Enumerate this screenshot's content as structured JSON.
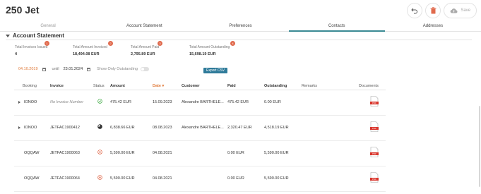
{
  "header": {
    "title": "250 Jet",
    "save_label": "Save"
  },
  "tabs": [
    {
      "label": "General"
    },
    {
      "label": "Account Statement"
    },
    {
      "label": "Preferences"
    },
    {
      "label": "Contacts"
    },
    {
      "label": "Addresses"
    }
  ],
  "section": {
    "title": "Account Statement"
  },
  "summary": [
    {
      "badge": "1",
      "label": "Total Invoices Issued",
      "value": "4"
    },
    {
      "badge": "2",
      "label": "Total Amount Invoiced",
      "value": "18,494.08 EUR"
    },
    {
      "badge": "3",
      "label": "Total Amount Paid",
      "value": "2,795.89 EUR"
    },
    {
      "badge": "4",
      "label": "Total Amount Outstanding",
      "value": "15,698.19 EUR"
    }
  ],
  "filters": {
    "date_from": "04.10.2019",
    "until_label": "until",
    "date_to": "23.01.2024",
    "outstanding_label": "Show Only Outstanding",
    "export_label": "Export CSV"
  },
  "table": {
    "headers": {
      "booking": "Booking",
      "invoice": "Invoice",
      "status": "Status",
      "amount": "Amount",
      "date": "Date",
      "customer": "Customer",
      "paid": "Paid",
      "outstanding": "Outstanding",
      "remarks": "Remarks",
      "documents": "Documents"
    },
    "rows": [
      {
        "booking": "IONOO",
        "invoice": "No Invoice Number",
        "status": "paid",
        "amount": "475.42 EUR",
        "date": "15.09.2023",
        "customer": "Alexandre BARTHELE...",
        "paid": "475.42 EUR",
        "outstanding": "0.00 EUR",
        "remarks": ""
      },
      {
        "booking": "IONOO",
        "invoice": "JETFAC1900412",
        "status": "partial",
        "amount": "6,838.66 EUR",
        "date": "08.08.2023",
        "customer": "Alexandre BARTHELE...",
        "paid": "2,320.47 EUR",
        "outstanding": "4,518.19 EUR",
        "remarks": ""
      },
      {
        "booking": "OQQAW",
        "invoice": "JETFAC1900063",
        "status": "unpaid",
        "amount": "5,590.00 EUR",
        "date": "04.08.2021",
        "customer": "",
        "paid": "0.00 EUR",
        "outstanding": "5,590.00 EUR",
        "remarks": ""
      },
      {
        "booking": "OQQAW",
        "invoice": "JETFAC1900064",
        "status": "unpaid",
        "amount": "5,590.00 EUR",
        "date": "04.08.2021",
        "customer": "",
        "paid": "0.00 EUR",
        "outstanding": "5,590.00 EUR",
        "remarks": ""
      }
    ]
  },
  "colors": {
    "accent": "#3b8a94",
    "orange": "#e07a3a",
    "export": "#2f7b9a",
    "delete": "#e06a4d",
    "paid": "#4caf50",
    "unpaid": "#e06a4d"
  }
}
